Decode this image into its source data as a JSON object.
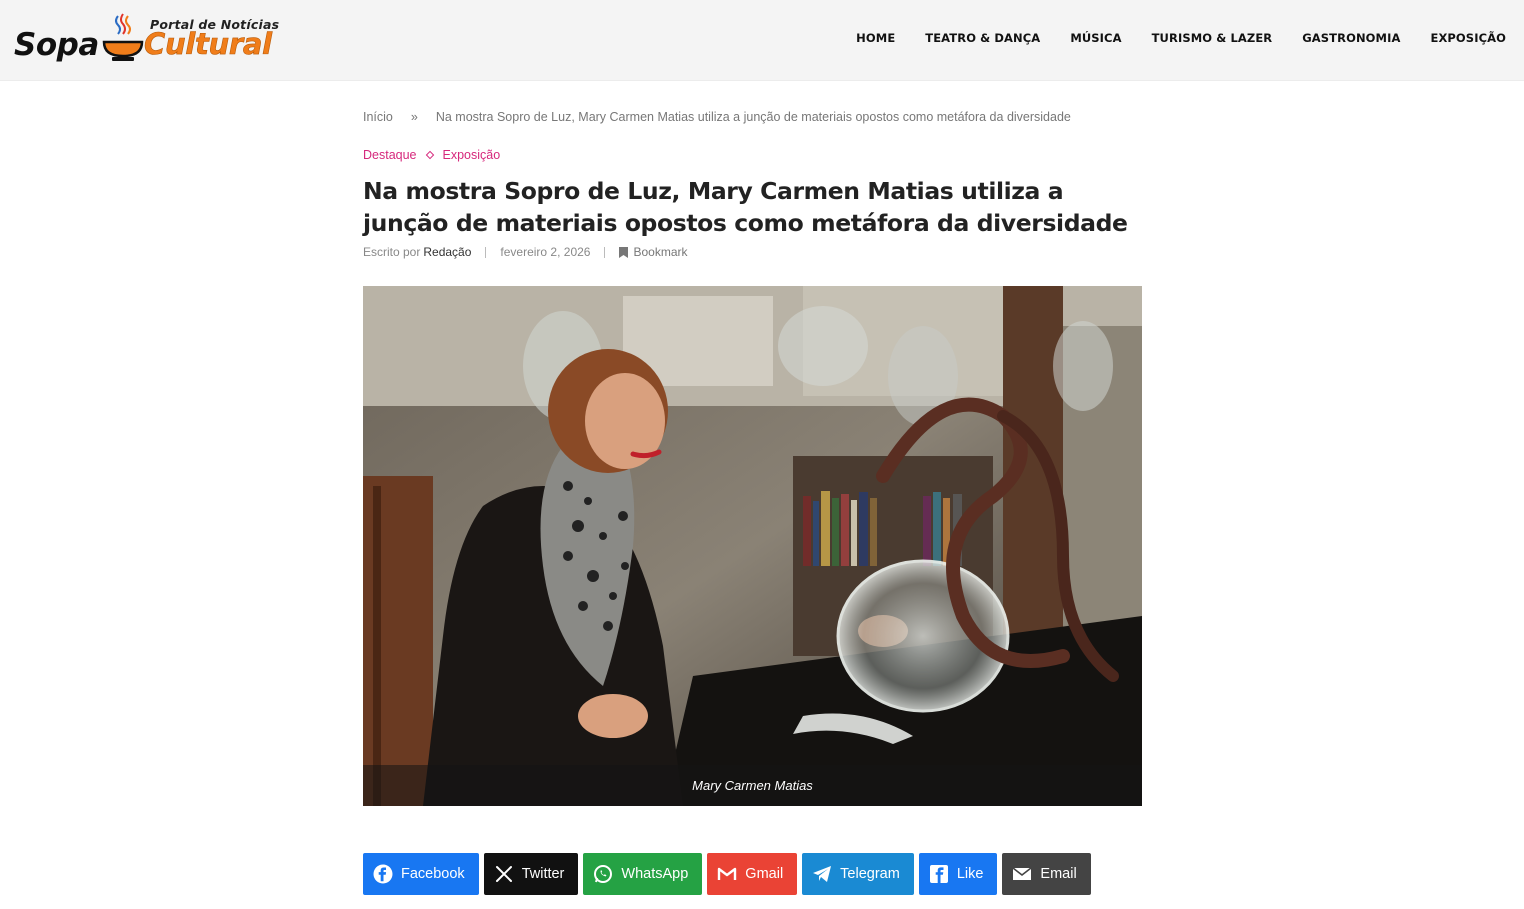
{
  "header": {
    "logo": {
      "tagline": "Portal de Notícias",
      "word1": "Sopa",
      "word2": "Cultural"
    },
    "nav": [
      "HOME",
      "TEATRO & DANÇA",
      "MÚSICA",
      "TURISMO & LAZER",
      "GASTRONOMIA",
      "EXPOSIÇÃO"
    ]
  },
  "breadcrumb": {
    "home": "Início",
    "separator": "»",
    "current": "Na mostra Sopro de Luz, Mary Carmen Matias utiliza a junção de materiais opostos como metáfora da diversidade"
  },
  "categories": [
    "Destaque",
    "Exposição"
  ],
  "article": {
    "title": "Na mostra Sopro de Luz, Mary Carmen Matias utiliza a junção de materiais opostos como metáfora da diversidade",
    "meta": {
      "written_by": "Escrito por",
      "author": "Redação",
      "date": "fevereiro 2, 2026",
      "bookmark": "Bookmark"
    },
    "image_caption": "Mary Carmen Matias"
  },
  "share": [
    {
      "label": "Facebook",
      "icon": "facebook-icon",
      "color": "#1877f2"
    },
    {
      "label": "Twitter",
      "icon": "x-icon",
      "color": "#111111"
    },
    {
      "label": "WhatsApp",
      "icon": "whatsapp-icon",
      "color": "#25a244"
    },
    {
      "label": "Gmail",
      "icon": "gmail-icon",
      "color": "#ea4335"
    },
    {
      "label": "Telegram",
      "icon": "telegram-icon",
      "color": "#1a8ad3"
    },
    {
      "label": "Like",
      "icon": "facebook-like-icon",
      "color": "#1877f2"
    },
    {
      "label": "Email",
      "icon": "envelope-icon",
      "color": "#444444"
    }
  ],
  "colors": {
    "accent": "#d6287c",
    "header_bg": "#f4f4f4",
    "logo_orange": "#f07d1a"
  }
}
